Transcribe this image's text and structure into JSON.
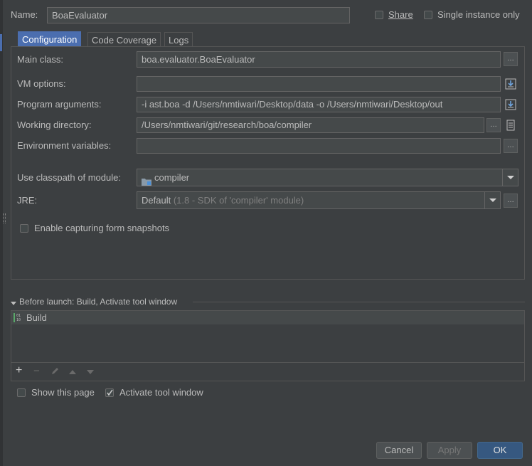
{
  "name": {
    "label": "Name:",
    "value": "BoaEvaluator"
  },
  "options": {
    "share": "Share",
    "single_instance": "Single instance only"
  },
  "tabs": [
    "Configuration",
    "Code Coverage",
    "Logs"
  ],
  "form": {
    "main_class": {
      "label": "Main class:",
      "value": "boa.evaluator.BoaEvaluator"
    },
    "vm_options": {
      "label": "VM options:",
      "value": ""
    },
    "program_args": {
      "label": "Program arguments:",
      "value": "-i ast.boa -d /Users/nmtiwari/Desktop/data -o /Users/nmtiwari/Desktop/out"
    },
    "working_dir": {
      "label": "Working directory:",
      "value": "/Users/nmtiwari/git/research/boa/compiler"
    },
    "env_vars": {
      "label": "Environment variables:",
      "value": ""
    },
    "classpath": {
      "label": "Use classpath of module:",
      "value": "compiler"
    },
    "jre": {
      "label": "JRE:",
      "value": "Default",
      "hint": "(1.8 - SDK of 'compiler' module)"
    },
    "snapshots": "Enable capturing form snapshots"
  },
  "before_launch": {
    "title": "Before launch: Build, Activate tool window",
    "items": [
      "Build"
    ],
    "toolbar": {
      "add": "+",
      "remove": "−"
    }
  },
  "show_this_page": "Show this page",
  "activate_tool_window": "Activate tool window",
  "buttons": {
    "cancel": "Cancel",
    "apply": "Apply",
    "ok": "OK"
  },
  "ellipsis": "…",
  "colors": {
    "accent": "#4b6eaf",
    "background": "#3c3f41",
    "field": "#45494a"
  }
}
